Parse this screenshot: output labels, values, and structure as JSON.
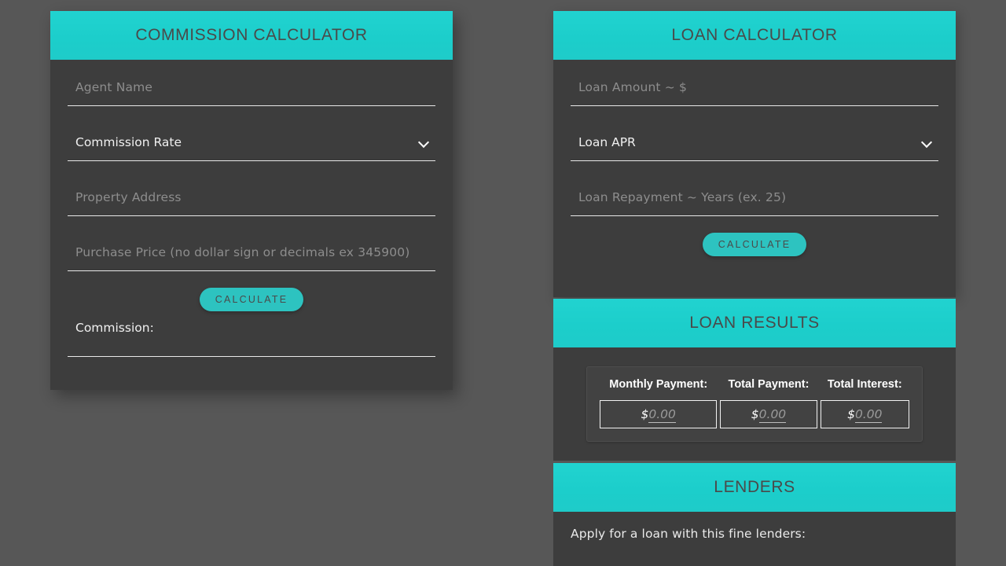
{
  "page": {
    "background_color": "#575757",
    "accent_color": "#21d3d0",
    "panel_color": "#3d3d3d"
  },
  "commission_calculator": {
    "title": "COMMISSION CALCULATOR",
    "agent_name_placeholder": "Agent Name",
    "commission_rate_label": "Commission Rate",
    "property_address_placeholder": "Property Address",
    "purchase_price_placeholder": "Purchase Price (no dollar sign or decimals ex 345900)",
    "calculate_label": "CALCULATE",
    "commission_label": "Commission:",
    "commission_value": ""
  },
  "loan_calculator": {
    "title": "LOAN CALCULATOR",
    "loan_amount_placeholder": "Loan Amount ~ $",
    "loan_apr_label": "Loan APR",
    "loan_repayment_placeholder": "Loan Repayment ~ Years (ex. 25)",
    "calculate_label": "CALCULATE"
  },
  "loan_results": {
    "title": "LOAN RESULTS",
    "headers": [
      "Monthly Payment:",
      "Total Payment:",
      "Total Interest:"
    ],
    "currency_sign": "$",
    "values": [
      "0.00",
      "0.00",
      "0.00"
    ]
  },
  "lenders": {
    "title": "LENDERS",
    "intro": "Apply for a loan with this fine lenders:"
  }
}
